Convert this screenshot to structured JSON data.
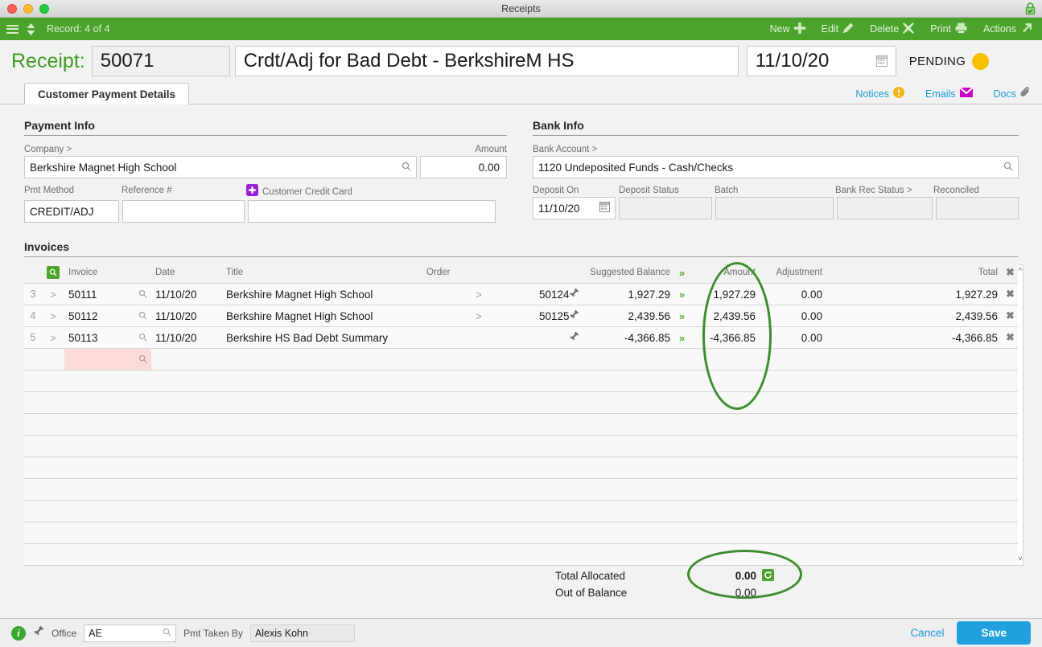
{
  "window": {
    "title": "Receipts",
    "lock_icon": "lock-icon"
  },
  "toolbar": {
    "menu_icon": "hamburger-menu-icon",
    "nav_icon": "record-stepper-icon",
    "record_label": "Record: 4 of 4",
    "actions": [
      {
        "label": "New",
        "icon": "plus-icon"
      },
      {
        "label": "Edit",
        "icon": "pencil-icon"
      },
      {
        "label": "Delete",
        "icon": "x-icon"
      },
      {
        "label": "Print",
        "icon": "printer-icon"
      },
      {
        "label": "Actions",
        "icon": "arrow-up-right-icon"
      }
    ]
  },
  "header": {
    "label": "Receipt:",
    "number": "50071",
    "title": "Crdt/Adj for Bad Debt - BerkshireM HS",
    "date": "11/10/20",
    "date_icon": "calendar-icon",
    "status": "PENDING",
    "status_color": "#f5c000"
  },
  "tabs": [
    {
      "label": "Customer Payment Details",
      "active": true
    }
  ],
  "tab_links": [
    {
      "label": "Notices",
      "icon": "warning-icon"
    },
    {
      "label": "Emails",
      "icon": "envelope-icon"
    },
    {
      "label": "Docs",
      "icon": "paperclip-icon"
    }
  ],
  "payment_info": {
    "section_title": "Payment Info",
    "company_label": "Company >",
    "company_value": "Berkshire Magnet High School",
    "company_icon": "magnifier-icon",
    "amount_label": "Amount",
    "amount_value": "0.00",
    "pmt_method_label": "Pmt Method",
    "pmt_method_value": "CREDIT/ADJ",
    "reference_label": "Reference #",
    "reference_value": "",
    "credit_card_label": "Customer Credit Card",
    "credit_card_icon": "add-card-icon",
    "credit_card_value": ""
  },
  "bank_info": {
    "section_title": "Bank Info",
    "bank_account_label": "Bank Account >",
    "bank_account_value": "1120 Undeposited Funds - Cash/Checks",
    "bank_account_icon": "magnifier-icon",
    "deposit_on_label": "Deposit On",
    "deposit_on_value": "11/10/20",
    "deposit_on_icon": "calendar-icon",
    "deposit_status_label": "Deposit Status",
    "deposit_status_value": "",
    "batch_label": "Batch",
    "batch_value": "",
    "bank_rec_status_label": "Bank Rec Status >",
    "bank_rec_status_value": "",
    "reconciled_label": "Reconciled",
    "reconciled_value": ""
  },
  "invoices": {
    "section_title": "Invoices",
    "search_icon": "grid-search-icon",
    "columns": {
      "invoice": "Invoice",
      "date": "Date",
      "title": "Title",
      "order": "Order",
      "suggested_balance": "Suggested Balance",
      "amount": "Amount",
      "adjustment": "Adjustment",
      "total": "Total",
      "clear_icon": "clear-all-icon",
      "push_icon": "push-all-icon"
    },
    "rows": [
      {
        "num": "3",
        "expand": ">",
        "invoice": "50111",
        "date": "11/10/20",
        "title": "Berkshire Magnet High School",
        "order_arrow": ">",
        "order": "50124",
        "pin_icon": "pin-icon",
        "suggested_balance": "1,927.29",
        "push_icon": "push-icon",
        "amount": "1,927.29",
        "adjustment": "0.00",
        "total": "1,927.29",
        "remove_icon": "remove-row-icon",
        "negative": false
      },
      {
        "num": "4",
        "expand": ">",
        "invoice": "50112",
        "date": "11/10/20",
        "title": "Berkshire Magnet High School",
        "order_arrow": ">",
        "order": "50125",
        "pin_icon": "pin-icon",
        "suggested_balance": "2,439.56",
        "push_icon": "push-icon",
        "amount": "2,439.56",
        "adjustment": "0.00",
        "total": "2,439.56",
        "remove_icon": "remove-row-icon",
        "negative": false
      },
      {
        "num": "5",
        "expand": ">",
        "invoice": "50113",
        "date": "11/10/20",
        "title": "Berkshire HS Bad Debt Summary",
        "order_arrow": "",
        "order": "",
        "pin_icon": "pin-icon",
        "suggested_balance": "-4,366.85",
        "push_icon": "push-icon",
        "amount": "-4,366.85",
        "adjustment": "0.00",
        "total": "-4,366.85",
        "remove_icon": "remove-row-icon",
        "negative": true
      }
    ],
    "new_row": {
      "placeholder": "",
      "icon": "magnifier-icon",
      "highlight_color": "#fbdcda"
    },
    "empty_rows": 9,
    "scrollbar": {
      "up_icon": "chevron-up-icon",
      "down_icon": "chevron-down-icon"
    }
  },
  "totals": {
    "total_allocated_label": "Total Allocated",
    "total_allocated_value": "0.00",
    "refresh_icon": "refresh-icon",
    "out_of_balance_label": "Out of Balance",
    "out_of_balance_value": "0.00"
  },
  "footer": {
    "info_icon": "info-icon",
    "pin_icon": "pin-icon",
    "office_label": "Office",
    "office_value": "AE",
    "office_icon": "magnifier-icon",
    "pmt_taken_by_label": "Pmt Taken By",
    "pmt_taken_by_value": "Alexis Kohn",
    "cancel_label": "Cancel",
    "save_label": "Save"
  },
  "annotations": {
    "accent_color": "#3d8c2e",
    "ellipse_amount_column": "amount-column-highlight",
    "ellipse_total_allocated": "total-allocated-highlight"
  }
}
